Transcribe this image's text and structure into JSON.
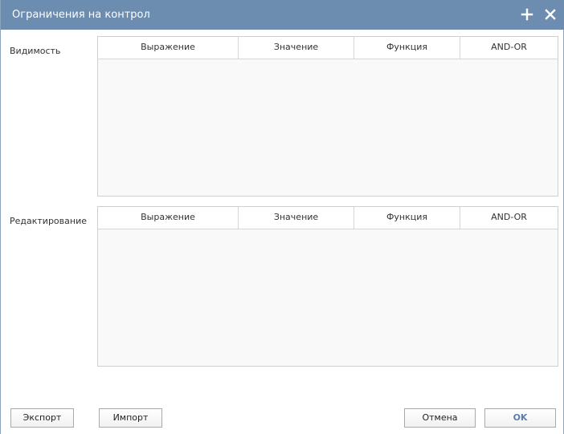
{
  "window": {
    "title": "Ограничения на контрол"
  },
  "sections": [
    {
      "label": "Видимость",
      "columns": [
        "Выражение",
        "Значение",
        "Функция",
        "AND-OR"
      ]
    },
    {
      "label": "Редактирование",
      "columns": [
        "Выражение",
        "Значение",
        "Функция",
        "AND-OR"
      ]
    }
  ],
  "buttons": {
    "export": "Экспорт",
    "import": "Импорт",
    "cancel": "Отмена",
    "ok": "OK"
  },
  "colors": {
    "titlebar": "#6c8cb0",
    "ok_text": "#5b7ea8"
  },
  "icons": {
    "add": "plus-icon",
    "close": "close-icon"
  }
}
